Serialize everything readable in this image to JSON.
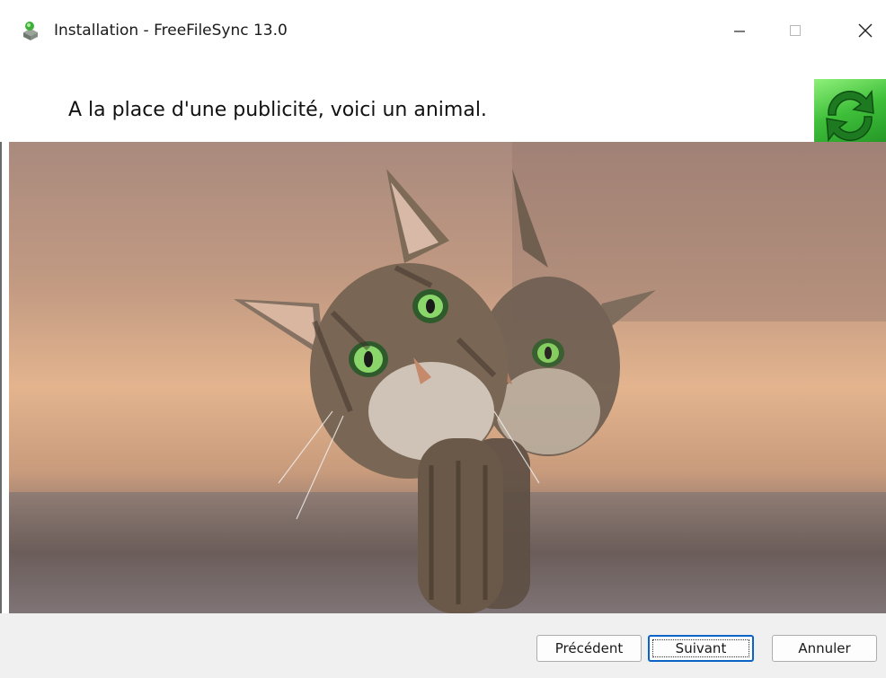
{
  "window": {
    "title": "Installation - FreeFileSync 13.0",
    "controls": {
      "minimize": "—",
      "maximize": "☐",
      "close": "✕"
    }
  },
  "header": {
    "message": "A la place d'une publicité, voici un animal."
  },
  "image": {
    "subject": "cat-photo"
  },
  "buttons": {
    "back": "Précédent",
    "next": "Suivant",
    "cancel": "Annuler"
  },
  "colors": {
    "logo_green": "#3fbf3a",
    "focus_blue": "#0a64c8",
    "footer_bg": "#f0f0f0"
  }
}
